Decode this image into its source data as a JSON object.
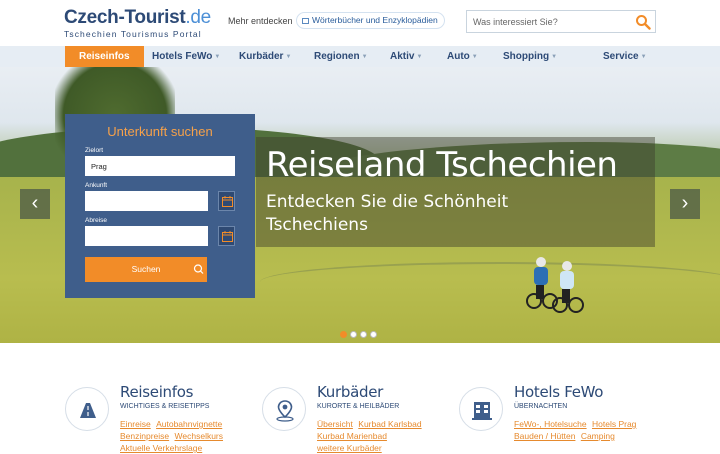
{
  "logo": {
    "name": "Czech-Tourist",
    "tld": ".de",
    "tagline": "Tschechien Tourismus Portal"
  },
  "header": {
    "more_label": "Mehr entdecken",
    "dict_link": "Wörterbücher und Enzyklopädien",
    "search_placeholder": "Was interessiert Sie?"
  },
  "nav": [
    {
      "label": "Reiseinfos",
      "active": true
    },
    {
      "label": "Hotels FeWo"
    },
    {
      "label": "Kurbäder"
    },
    {
      "label": "Regionen"
    },
    {
      "label": "Aktiv"
    },
    {
      "label": "Auto"
    },
    {
      "label": "Shopping"
    },
    {
      "label": "Service"
    }
  ],
  "hero": {
    "title": "Reiseland Tschechien",
    "subtitle": "Entdecken Sie die Schönheit Tschechiens",
    "slides_total": 4,
    "active_slide": 1
  },
  "booking": {
    "title": "Unterkunft suchen",
    "destination_label": "Zielort",
    "destination_value": "Prag",
    "arrival_label": "Ankunft",
    "arrival_value": "",
    "departure_label": "Abreise",
    "departure_value": "",
    "search_label": "Suchen"
  },
  "features": [
    {
      "title": "Reiseinfos",
      "subtitle": "WICHTIGES & REISETIPPS",
      "links": [
        "Einreise",
        "Autobahnvignette",
        "Benzinpreise",
        "Wechselkurs",
        "Aktuelle Verkehrslage"
      ]
    },
    {
      "title": "Kurbäder",
      "subtitle": "KURORTE & HEILBÄDER",
      "links": [
        "Übersicht",
        "Kurbad Karlsbad",
        "Kurbad Marienbad",
        "weitere Kurbäder"
      ]
    },
    {
      "title": "Hotels FeWo",
      "subtitle": "ÜBERNACHTEN",
      "links": [
        "FeWo-, Hotelsuche",
        "Hotels Prag",
        "Bauden / Hütten",
        "Camping"
      ]
    }
  ],
  "colors": {
    "brand": "#2d4a76",
    "accent": "#f28c28",
    "box": "#3f5e8b",
    "nav_bg": "#e6edf4"
  }
}
